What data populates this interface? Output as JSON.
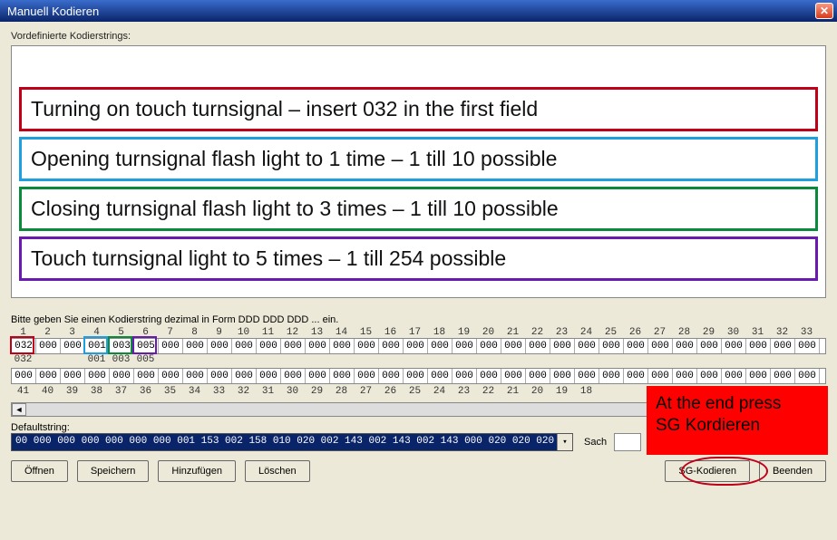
{
  "window": {
    "title": "Manuell Kodieren",
    "close_glyph": "✕"
  },
  "labels": {
    "predefined": "Vordefinierte Kodierstrings:",
    "prompt": "Bitte geben Sie einen Kodierstring dezimal in Form DDD DDD DDD ... ein.",
    "defaultstring": "Defaultstring:",
    "sach": "Sach"
  },
  "instructions": [
    {
      "color": "red",
      "text": "Turning on touch turnsignal – insert 032 in the first field"
    },
    {
      "color": "blue",
      "text": "Opening turnsignal flash light to 1 time – 1 till 10 possible"
    },
    {
      "color": "green",
      "text": "Closing turnsignal flash light to 3 times – 1 till 10 possible"
    },
    {
      "color": "purple",
      "text": "Touch turnsignal light to 5 times – 1 till 254 possible"
    }
  ],
  "ruler_top": [
    "1",
    "2",
    "3",
    "4",
    "5",
    "6",
    "7",
    "8",
    "9",
    "10",
    "11",
    "12",
    "13",
    "14",
    "15",
    "16",
    "17",
    "18",
    "19",
    "20",
    "21",
    "22",
    "23",
    "24",
    "25",
    "26",
    "27",
    "28",
    "29",
    "30",
    "31",
    "32",
    "33"
  ],
  "code_row1": [
    "032",
    "000",
    "000",
    "001",
    "003",
    "005",
    "000",
    "000",
    "000",
    "000",
    "000",
    "000",
    "000",
    "000",
    "000",
    "000",
    "000",
    "000",
    "000",
    "000",
    "000",
    "000",
    "000",
    "000",
    "000",
    "000",
    "000",
    "000",
    "000",
    "000",
    "000",
    "000",
    "000"
  ],
  "defaults_below": [
    "032",
    "",
    "",
    "001",
    "003",
    "005",
    "",
    "",
    "",
    "",
    "",
    "",
    "",
    "",
    "",
    "",
    "",
    "",
    "",
    "",
    "",
    "",
    "",
    "",
    "",
    "",
    "",
    "",
    "",
    "",
    "",
    "",
    ""
  ],
  "code_row2": [
    "000",
    "000",
    "000",
    "000",
    "000",
    "000",
    "000",
    "000",
    "000",
    "000",
    "000",
    "000",
    "000",
    "000",
    "000",
    "000",
    "000",
    "000",
    "000",
    "000",
    "000",
    "000",
    "000",
    "000",
    "000",
    "000",
    "000",
    "000",
    "000",
    "000",
    "000",
    "000",
    "000"
  ],
  "ruler_bottom": [
    "41",
    "40",
    "39",
    "38",
    "37",
    "36",
    "35",
    "34",
    "33",
    "32",
    "31",
    "30",
    "29",
    "28",
    "27",
    "26",
    "25",
    "24",
    "23",
    "22",
    "21",
    "20",
    "19",
    "18"
  ],
  "highlights": [
    {
      "color": "#c00018",
      "column": 0
    },
    {
      "color": "#1ea0e0",
      "column": 3
    },
    {
      "color": "#0a8a3a",
      "column": 4
    },
    {
      "color": "#6a1ab0",
      "column": 5
    }
  ],
  "defaultstring_value": "00 000 000 000 000 000 000 001 153 002 158 010 020 002 143 002 143 002 143 000 020 020 020",
  "buttons": {
    "open": "Öffnen",
    "save": "Speichern",
    "add": "Hinzufügen",
    "delete": "Löschen",
    "sgkodieren": "SG-Kodieren",
    "end": "Beenden"
  },
  "callout": {
    "line1": "At the end press",
    "line2": "SG Kordieren"
  },
  "scroll": {
    "left_glyph": "◄",
    "right_glyph": "►",
    "down_glyph": "▾"
  }
}
